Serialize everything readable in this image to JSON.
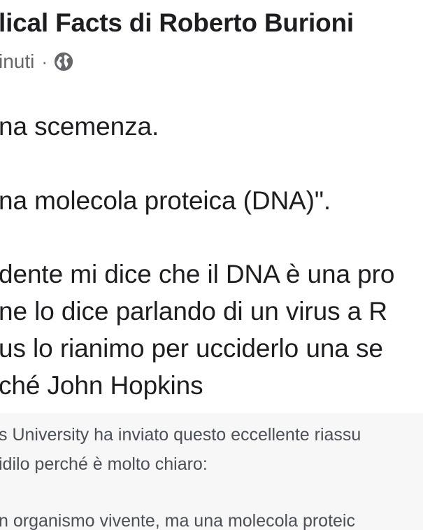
{
  "post": {
    "author": "lical Facts di Roberto Burioni",
    "time": "inuti",
    "separator": "·",
    "privacy_icon": "globe-icon",
    "lines": [
      "na scemenza.",
      "na molecola proteica (DNA)\".",
      "dente mi dice che il DNA è una pro",
      "ne lo dice parlando di un virus a R",
      "us lo rianimo per ucciderlo una se",
      "ché John Hopkins"
    ]
  },
  "shared": {
    "lines": [
      "s University ha inviato questo eccellente riassu",
      "idilo perché è molto chiaro:",
      "n organismo vivente, ma una molecola proteic"
    ]
  }
}
